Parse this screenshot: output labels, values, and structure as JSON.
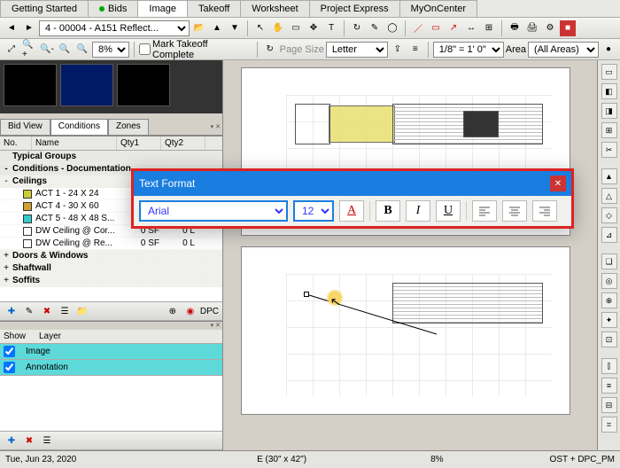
{
  "tabs": [
    "Getting Started",
    "Bids",
    "Image",
    "Takeoff",
    "Worksheet",
    "Project Express",
    "MyOnCenter"
  ],
  "active_tab": "Image",
  "nav": {
    "bid_combo": "4 - 00004 - A151 Reflect..."
  },
  "toolbar2": {
    "mark_complete": "Mark Takeoff Complete",
    "page_size_label": "Page Size",
    "page_size_value": "Letter",
    "scale": "1/8\" = 1' 0\"",
    "area_label": "Area",
    "area_value": "(All Areas)",
    "zoom": "8%"
  },
  "subtabs": [
    "Bid View",
    "Conditions",
    "Zones"
  ],
  "grid": {
    "cols": [
      "No.",
      "Name",
      "Qty1",
      "Qty2"
    ]
  },
  "tree": {
    "groups": [
      {
        "label": "Typical Groups",
        "expander": ""
      },
      {
        "label": "Conditions - Documentation",
        "expander": "-"
      }
    ],
    "ceilings_label": "Ceilings",
    "items": [
      {
        "name": "ACT 1 - 24 X 24",
        "color": "#cccc33",
        "q1": "",
        "q2": ""
      },
      {
        "name": "ACT 4 - 30 X 60",
        "color": "#d0a030",
        "q1": "",
        "q2": ""
      },
      {
        "name": "ACT 5 - 48 X 48 S...",
        "color": "#33cccc",
        "q1": "",
        "q2": ""
      },
      {
        "name": "DW Ceiling @ Cor...",
        "color": "#ffffff",
        "q1": "0 SF",
        "q2": "0 L"
      },
      {
        "name": "DW Ceiling @ Re...",
        "color": "#ffffff",
        "q1": "0 SF",
        "q2": "0 L"
      }
    ],
    "other": [
      "Doors & Windows",
      "Shaftwall",
      "Soffits"
    ]
  },
  "dpc_label": "DPC",
  "layers": {
    "head": [
      "Show",
      "Layer"
    ],
    "rows": [
      "Image",
      "Annotation"
    ]
  },
  "status": {
    "date": "Tue, Jun 23, 2020",
    "paper": "E (30\" x 42\")",
    "zoom": "8%",
    "user": "OST + DPC_PM"
  },
  "dialog": {
    "title": "Text Format",
    "font": "Arial",
    "size": "12",
    "btns": {
      "color": "A",
      "bold": "B",
      "italic": "I",
      "underline": "U"
    }
  }
}
